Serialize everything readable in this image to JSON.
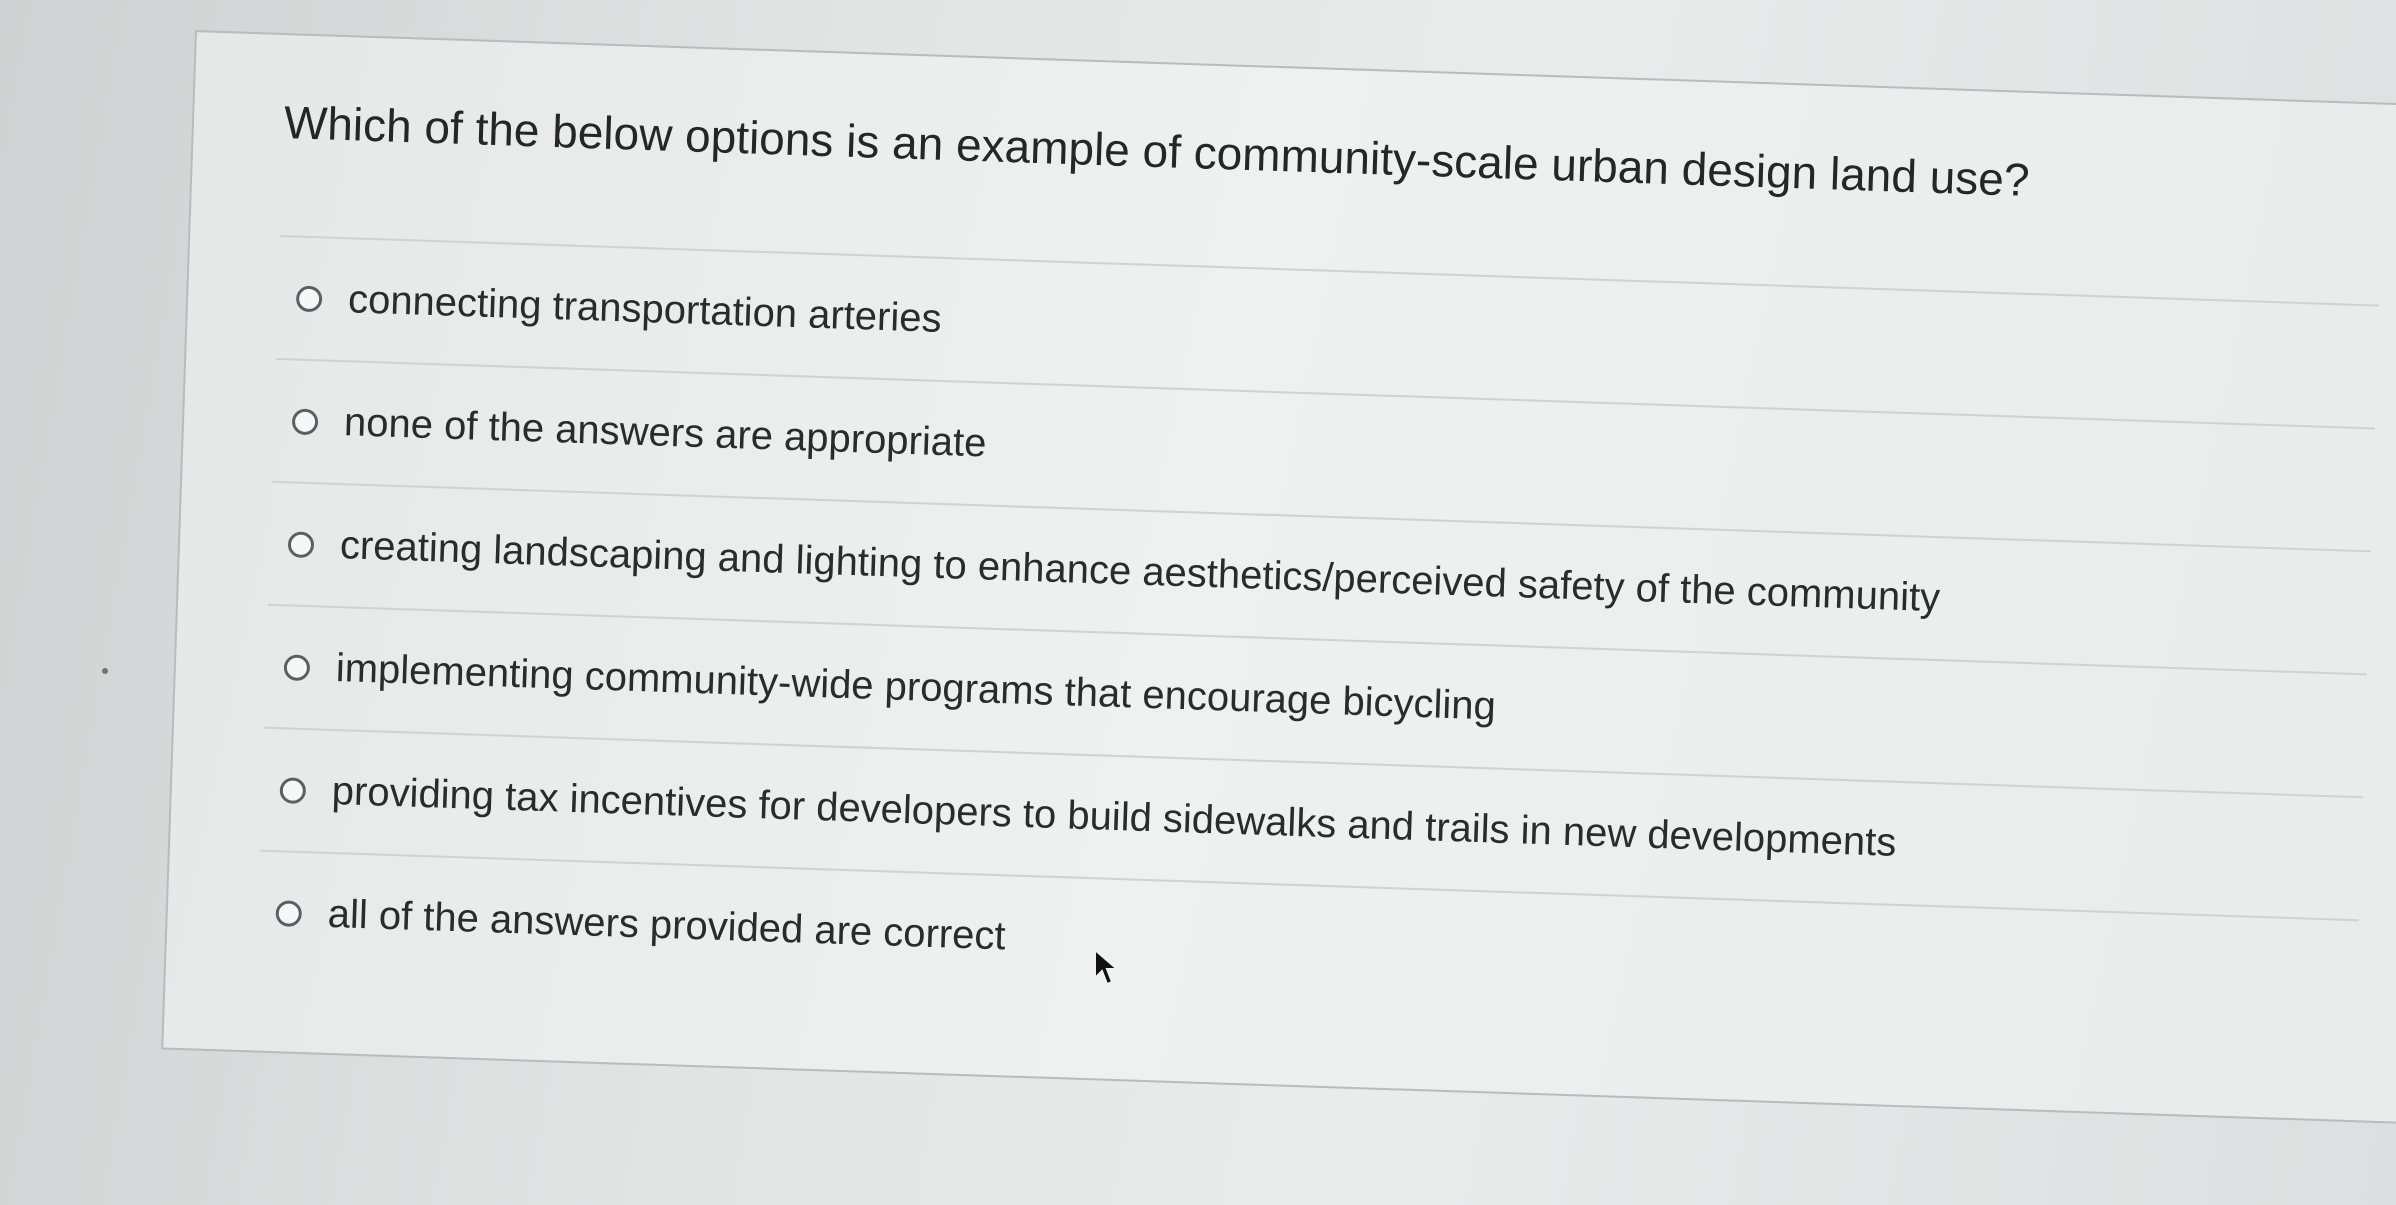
{
  "question": {
    "text": "Which of the below options is an example of  community-scale urban design land use?"
  },
  "answers": [
    {
      "label": "connecting transportation arteries",
      "selected": false
    },
    {
      "label": "none of the answers are appropriate",
      "selected": false
    },
    {
      "label": "creating landscaping and lighting to enhance aesthetics/perceived safety of the community",
      "selected": false
    },
    {
      "label": "implementing community-wide programs that encourage bicycling",
      "selected": false
    },
    {
      "label": "providing tax incentives for developers to build sidewalks and trails in new developments",
      "selected": false
    },
    {
      "label": "all of the answers provided are correct",
      "selected": false
    }
  ],
  "icons": {
    "radio": "radio-button-icon",
    "cursor": "mouse-pointer-icon"
  }
}
